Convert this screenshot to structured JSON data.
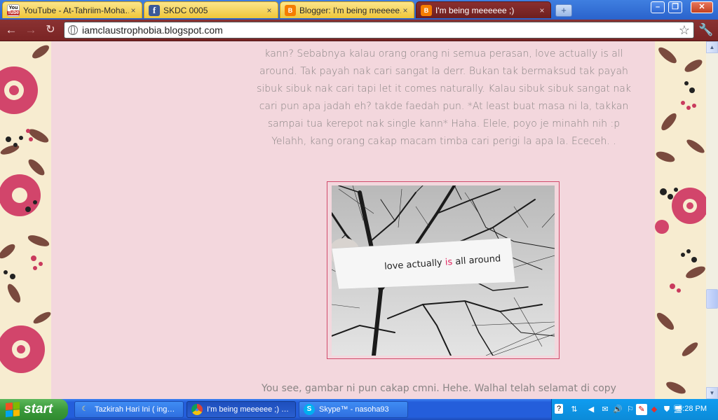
{
  "tabs": [
    {
      "label": "YouTube - At-Tahriim-Moha…",
      "icon": "youtube-icon",
      "close": "×"
    },
    {
      "label": "SKDC 0005",
      "icon": "facebook-icon",
      "close": "×"
    },
    {
      "label": "Blogger: I'm being meeeee…",
      "icon": "blogger-icon",
      "close": "×"
    },
    {
      "label": "I'm being meeeeee ;)",
      "icon": "blogger-icon",
      "close": "×"
    }
  ],
  "favicons": {
    "youtube_top": "You",
    "youtube_bottom": "Tube",
    "facebook": "f",
    "blogger": "B"
  },
  "window": {
    "minimize": "–",
    "maximize": "❐",
    "close": "✕",
    "new_tab": "+"
  },
  "toolbar": {
    "back": "←",
    "forward": "→",
    "reload": "↻",
    "url": "iamclaustrophobia.blogspot.com",
    "star": "☆",
    "wrench": "🔧"
  },
  "post": {
    "paragraph": "kann? Sebabnya kalau orang orang ni semua perasan, love actually is all around. Tak payah nak cari sangat la derr. Bukan tak bermaksud tak payah sibuk sibuk nak cari tapi let it comes naturally. Kalau sibuk sibuk sangat nak cari pun apa jadah eh? takde faedah pun. *At least buat masa ni la, takkan sampai tua kerepot nak single kann* Haha. Elele, poyo je minahh nih :p Yelahh, kang orang cakap macam timba cari perigi la apa la. Ececeh. .",
    "image_text": {
      "before": "love actually ",
      "highlight": "is",
      "after": " all around"
    },
    "next_paragraph": "You see, gambar ni pun cakap cmni. Hehe. Walhal telah selamat di copy"
  },
  "colors": {
    "accent_pink": "#d14a6a",
    "page_bg": "#f3d7dd",
    "text": "#8a8585",
    "chrome_theme": "#7a2424"
  },
  "scrollbar": {
    "up": "▲",
    "down": "▼",
    "position_fraction": 0.75
  },
  "taskbar": {
    "start_label": "start",
    "tasks": [
      {
        "label": "Tazkirah Hari Ini ( ing…",
        "icon": "crescent-icon",
        "glyph": "☾"
      },
      {
        "label": "I'm being meeeeee ;) …",
        "icon": "chrome-icon",
        "glyph": "●"
      },
      {
        "label": "Skype™ - nasoha93",
        "icon": "skype-icon",
        "glyph": "S"
      }
    ],
    "tray_icons": [
      "?",
      "⇅",
      "◀",
      "✉",
      "🔊",
      "⚐",
      "✎",
      "◆",
      "⛊",
      "🖥"
    ],
    "clock": "9:28 PM"
  }
}
